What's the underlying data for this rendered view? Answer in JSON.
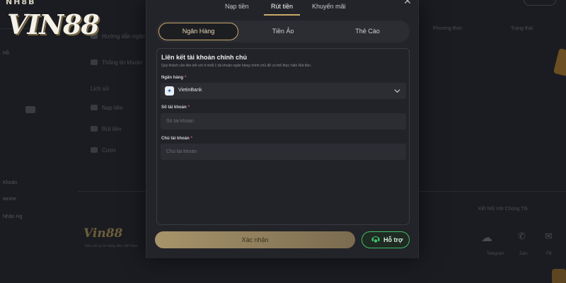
{
  "logo": {
    "text": "VIN88",
    "top_text": "NH8B"
  },
  "background": {
    "sidebar_items": [
      "Hỗ",
      "",
      "",
      "",
      "",
      "",
      "Khoản",
      "tanine",
      "Nhận Hg",
      "",
      ""
    ],
    "middle_items": [
      "Hướng dẫn ngân hàng",
      "Thông tin khoản",
      "Lịch sử",
      "Nạp tiền",
      "Rút tiền",
      "Cược"
    ],
    "right_header_1": "Phương thức",
    "right_header_2": "Trạng thái",
    "footer_logo": "Vin88",
    "footer_sub": "Nhà cái uy tín hàng đầu Việt Nam",
    "social_label": "Kết Nối Với Chúng Tôi",
    "social_items": [
      "Telegram",
      "Zalo",
      "FB"
    ]
  },
  "modal": {
    "top_tabs": [
      {
        "label": "Nạp tiền",
        "active": false
      },
      {
        "label": "Rút tiền",
        "active": true
      },
      {
        "label": "Khuyến mãi",
        "active": false
      }
    ],
    "sub_tabs": [
      {
        "label": "Ngân Hàng",
        "active": true
      },
      {
        "label": "Tiền Ảo",
        "active": false
      },
      {
        "label": "Thẻ Cào",
        "active": false
      }
    ],
    "panel": {
      "title": "Liên kết tài khoản chính chủ",
      "description": "Quý khách cần liên kết với ít nhất 1 tài khoản ngân hàng chính chủ để có thể thực hiện Rút tiền.",
      "bank_label": "Ngân hàng",
      "bank_value": "VietinBank",
      "account_number_label": "Số tài khoản",
      "account_number_placeholder": "Số tài khoản",
      "account_holder_label": "Chủ tài khoản",
      "account_holder_placeholder": "Chủ tài khoản",
      "required_mark": "*"
    },
    "confirm_label": "Xác nhận",
    "support_label": "Hỗ trợ"
  },
  "colors": {
    "accent_gold": "#c9a86a",
    "support_green": "#3fbf6a",
    "modal_bg": "#232429"
  }
}
